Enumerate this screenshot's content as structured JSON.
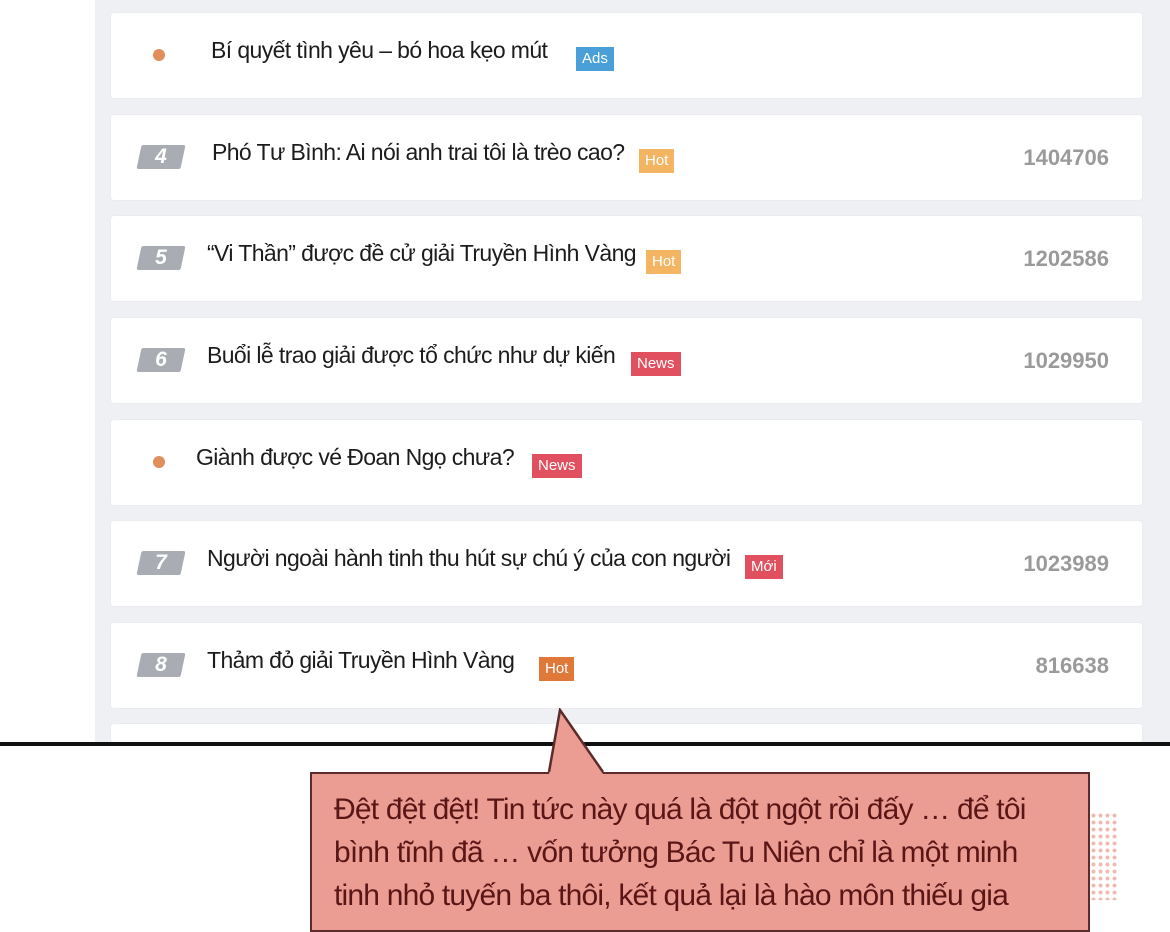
{
  "rows": [
    {
      "marker": "dot",
      "title": "Bí quyết tình yêu – bó hoa kẹo mút",
      "badge": "Ads",
      "badge_color": "#4a9fd8"
    },
    {
      "marker": "rank",
      "rank": "4",
      "title": "Phó Tư Bình: Ai nói anh trai tôi là trèo cao?",
      "badge": "Hot",
      "badge_color": "#f3b562",
      "count": "1404706"
    },
    {
      "marker": "rank",
      "rank": "5",
      "title": "“Vi Thần” được đề cử giải Truyền Hình Vàng",
      "badge": "Hot",
      "badge_color": "#f3b562",
      "count": "1202586"
    },
    {
      "marker": "rank",
      "rank": "6",
      "title": "Buổi lễ trao giải được tổ chức như dự kiến",
      "badge": "News",
      "badge_color": "#e0505e",
      "count": "1029950"
    },
    {
      "marker": "dot",
      "title": "Giành được vé Đoan Ngọ chưa?",
      "badge": "News",
      "badge_color": "#e0505e"
    },
    {
      "marker": "rank",
      "rank": "7",
      "title": "Người ngoài hành tinh thu hút sự chú ý của con người",
      "badge": "Mới",
      "badge_color": "#e0505e",
      "count": "1023989"
    },
    {
      "marker": "rank",
      "rank": "8",
      "title": "Thảm đỏ giải Truyền Hình Vàng",
      "badge": "Hot",
      "badge_color": "#e0783a",
      "count": "816638"
    }
  ],
  "speech_bubble": {
    "line1": "Đệt đệt đệt! Tin tức này quá là đột ngột rồi đấy … để tôi",
    "line2": "bình tĩnh đã … vốn tưởng Bác Tu Niên chỉ là một minh",
    "line3": "tinh nhỏ tuyến ba thôi, kết quả lại là hào môn thiếu gia"
  }
}
